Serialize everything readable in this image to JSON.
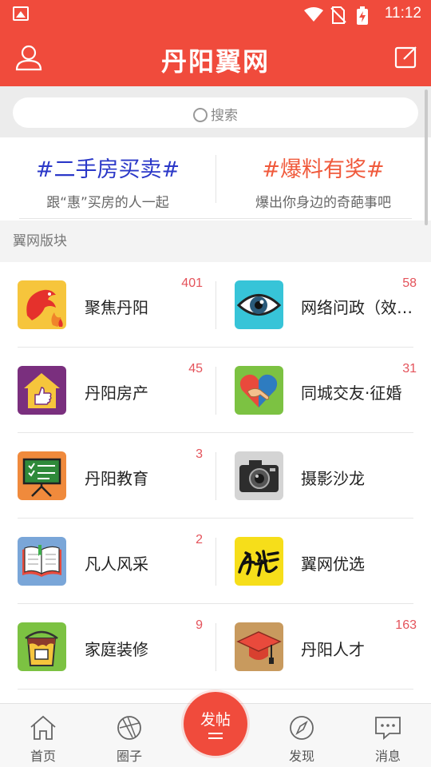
{
  "status_bar": {
    "time": "11:12"
  },
  "header": {
    "title": "丹阳翼网"
  },
  "search": {
    "placeholder": "搜索"
  },
  "promos": [
    {
      "title": "#二手房买卖#",
      "subtitle": "跟“惠”买房的人一起",
      "color": "#2b38c8"
    },
    {
      "title": "#爆料有奖#",
      "subtitle": "爆出你身边的奇葩事吧",
      "color": "#f05a3c"
    }
  ],
  "section": {
    "title": "翼网版块"
  },
  "boards": [
    {
      "left": {
        "name": "聚焦丹阳",
        "count": "401",
        "icon": "phoenix-icon"
      },
      "right": {
        "name": "网络问政（效…",
        "count": "58",
        "icon": "eye-icon"
      }
    },
    {
      "left": {
        "name": "丹阳房产",
        "count": "45",
        "icon": "house-thumb-icon"
      },
      "right": {
        "name": "同城交友·征婚",
        "count": "31",
        "icon": "heart-handshake-icon"
      }
    },
    {
      "left": {
        "name": "丹阳教育",
        "count": "3",
        "icon": "blackboard-icon"
      },
      "right": {
        "name": "摄影沙龙",
        "count": "",
        "icon": "camera-icon"
      }
    },
    {
      "left": {
        "name": "凡人风采",
        "count": "2",
        "icon": "open-book-icon"
      },
      "right": {
        "name": "翼网优选",
        "count": "",
        "icon": "shengqian-icon"
      }
    },
    {
      "left": {
        "name": "家庭装修",
        "count": "9",
        "icon": "paint-bucket-icon"
      },
      "right": {
        "name": "丹阳人才",
        "count": "163",
        "icon": "graduation-cap-icon"
      }
    }
  ],
  "tabbar": {
    "home": "首页",
    "circle": "圈子",
    "post": "发帖",
    "discover": "发现",
    "messages": "消息"
  },
  "colors": {
    "brand": "#f04b3c",
    "count": "#e4535b"
  }
}
